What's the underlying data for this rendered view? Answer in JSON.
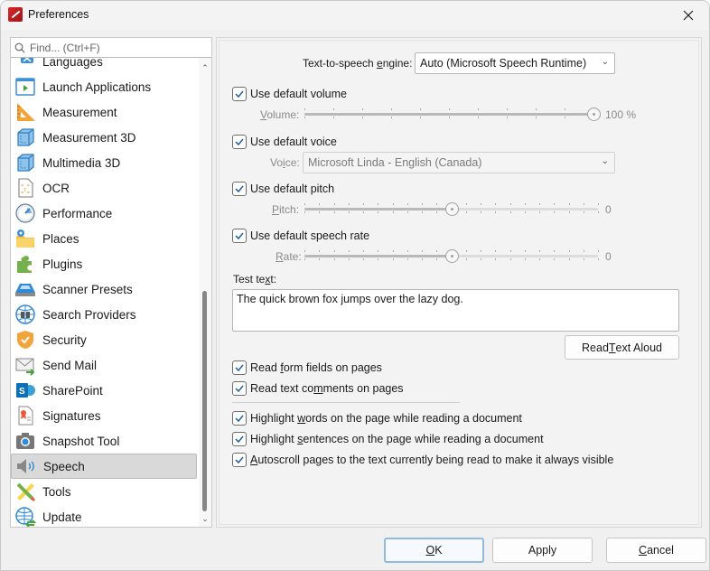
{
  "window": {
    "title": "Preferences",
    "close_label": "Close"
  },
  "sidebar": {
    "search_placeholder": "Find... (Ctrl+F)",
    "items": [
      {
        "label": "Languages",
        "icon": "languages-icon"
      },
      {
        "label": "Launch Applications",
        "icon": "launch-applications-icon"
      },
      {
        "label": "Measurement",
        "icon": "ruler-triangle-icon"
      },
      {
        "label": "Measurement 3D",
        "icon": "cube-icon"
      },
      {
        "label": "Multimedia 3D",
        "icon": "cube-icon"
      },
      {
        "label": "OCR",
        "icon": "ocr-document-icon"
      },
      {
        "label": "Performance",
        "icon": "gauge-icon"
      },
      {
        "label": "Places",
        "icon": "folder-pin-icon"
      },
      {
        "label": "Plugins",
        "icon": "puzzle-icon"
      },
      {
        "label": "Scanner Presets",
        "icon": "scanner-icon"
      },
      {
        "label": "Search Providers",
        "icon": "globe-binoculars-icon"
      },
      {
        "label": "Security",
        "icon": "shield-icon"
      },
      {
        "label": "Send Mail",
        "icon": "envelope-icon"
      },
      {
        "label": "SharePoint",
        "icon": "sharepoint-icon"
      },
      {
        "label": "Signatures",
        "icon": "certificate-icon"
      },
      {
        "label": "Snapshot Tool",
        "icon": "camera-icon"
      },
      {
        "label": "Speech",
        "icon": "speaker-icon",
        "selected": true
      },
      {
        "label": "Tools",
        "icon": "tools-icon"
      },
      {
        "label": "Update",
        "icon": "globe-refresh-icon"
      }
    ]
  },
  "speech": {
    "engine_label_pre": "Text-to-speech ",
    "engine_label_u": "e",
    "engine_label_post": "ngine:",
    "engine_value": "Auto (Microsoft Speech Runtime)",
    "use_default_volume": {
      "label": "Use default volume",
      "checked": true
    },
    "volume": {
      "label_u": "V",
      "label_rest": "olume:",
      "value_percent": 100,
      "value_text": "100 %"
    },
    "use_default_voice": {
      "label": "Use default voice",
      "checked": true
    },
    "voice": {
      "label_pre": "Vo",
      "label_u": "i",
      "label_post": "ce:",
      "value": "Microsoft Linda - English (Canada)"
    },
    "use_default_pitch": {
      "label": "Use default pitch",
      "checked": true
    },
    "pitch": {
      "label_u": "P",
      "label_rest": "itch:",
      "value": 0,
      "value_text": "0",
      "min": -10,
      "max": 10
    },
    "use_default_rate": {
      "label": "Use default speech rate",
      "checked": true
    },
    "rate": {
      "label_u": "R",
      "label_rest": "ate:",
      "value": 0,
      "value_text": "0",
      "min": -10,
      "max": 10
    },
    "test_text_label_pre": "Test te",
    "test_text_label_u": "x",
    "test_text_label_post": "t:",
    "test_text_value": "The quick brown fox jumps over the lazy dog.",
    "read_aloud": {
      "pre": "Read ",
      "u": "T",
      "post": "ext Aloud"
    },
    "options": [
      {
        "pre": "Read ",
        "u": "f",
        "post": "orm fields on pages",
        "checked": true
      },
      {
        "pre": "Read text co",
        "u": "m",
        "post": "ments on pages",
        "checked": true
      },
      {
        "pre": "Highlight ",
        "u": "w",
        "post": "ords on the page while reading a document",
        "checked": true
      },
      {
        "pre": "Highlight ",
        "u": "s",
        "post": "entences on the page while reading a document",
        "checked": true
      },
      {
        "pre": "",
        "u": "A",
        "post": "utoscroll pages to the text currently being read to make it always visible",
        "checked": true
      }
    ]
  },
  "footer": {
    "ok": {
      "u": "O",
      "post": "K"
    },
    "apply": {
      "label": "Apply"
    },
    "cancel": {
      "u": "C",
      "post": "ancel"
    }
  }
}
